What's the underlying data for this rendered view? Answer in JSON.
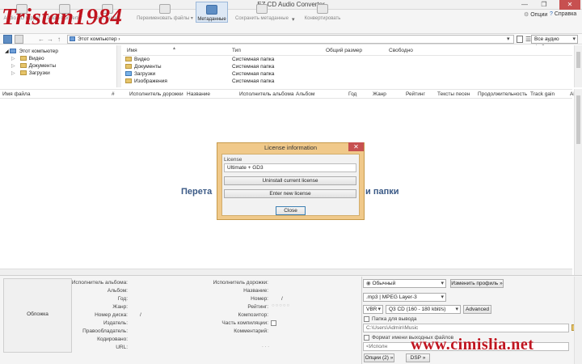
{
  "window": {
    "title": "EZ CD Audio Converter",
    "controls": {
      "minimize": "—",
      "maximize": "❐",
      "close": "✕"
    }
  },
  "watermarks": {
    "top": "Tristan1984",
    "bottom": "www.cimislia.net"
  },
  "toolbar": {
    "buttons": [
      {
        "label": "Audio CD Ripper"
      },
      {
        "label": "Audio Converter"
      },
      {
        "label": "Disc Burner"
      },
      {
        "label": "Переименовать файлы ▾"
      },
      {
        "label": "Метаданные"
      },
      {
        "label": "Сохранить метаданные"
      },
      {
        "label": "Конвертировать"
      }
    ],
    "options_label": "Опции",
    "help_label": "Справка"
  },
  "address": {
    "path": "Этот компьютер ›",
    "filter": "Все аудио файлы"
  },
  "tree": {
    "root": "Этот компьютер",
    "items": [
      "Видео",
      "Документы",
      "Загрузки"
    ]
  },
  "files": {
    "columns": {
      "name": "Имя",
      "type": "Тип",
      "total": "Общий размер",
      "free": "Свободно"
    },
    "rows": [
      {
        "name": "Видео",
        "type": "Системная папка"
      },
      {
        "name": "Документы",
        "type": "Системная папка"
      },
      {
        "name": "Загрузки",
        "type": "Системная папка"
      },
      {
        "name": "Изображения",
        "type": "Системная папка"
      }
    ]
  },
  "tracks": {
    "columns": [
      "Имя файла",
      "#",
      "Исполнитель дорожки",
      "Название",
      "Исполнитель альбома",
      "Альбом",
      "Год",
      "Жанр",
      "Рейтинг",
      "Тексты песен",
      "Продолжительность",
      "Track gain",
      "Album gain"
    ],
    "drop_text": "Перета",
    "drop_text_tail": "и папки"
  },
  "metadata": {
    "cover_label": "Обложка",
    "left_fields": [
      "Исполнитель альбома:",
      "Альбом:",
      "Год:",
      "Жанр:",
      "Номер диска:",
      "Издатель:",
      "Правообладатель:",
      "Кодировано:",
      "URL:"
    ],
    "disc_number_sep": "/",
    "right_fields": [
      "Исполнитель дорожки:",
      "Название:",
      "Номер:",
      "Рейтинг:",
      "Композитор:",
      "Часть компиляции:",
      "Комментарий:"
    ],
    "track_number_sep": "/",
    "rating_stars": "○○○○○",
    "comment_dots": ". . ."
  },
  "output": {
    "profile": "Обычный",
    "change_profile": "Изменить профиль »",
    "format": ".mp3 | MPEG Layer-3",
    "mode": "VBR",
    "quality": "Q3  CD  (160 - 180 kbit/s)",
    "advanced": "Advanced",
    "folder_checkbox_label": "Папка для вывода",
    "folder_path": "C:\\Users\\Admin\\Music",
    "filename_checkbox_label": "Формат имени выходных файлов",
    "filename_pattern": "<Исполн",
    "options_button": "Опции (2) »",
    "dsp_button": "DSP »"
  },
  "dialog": {
    "title": "License information",
    "license_label": "License",
    "license_value": "Ultimate + GD3",
    "uninstall": "Uninstall current license",
    "enter_new": "Enter new license",
    "close": "Close",
    "close_icon": "✕"
  },
  "colors": {
    "accent": "#3b5a86",
    "dialog_frame": "#f0c98a",
    "close_red": "#c75050",
    "watermark": "#c0141f"
  }
}
